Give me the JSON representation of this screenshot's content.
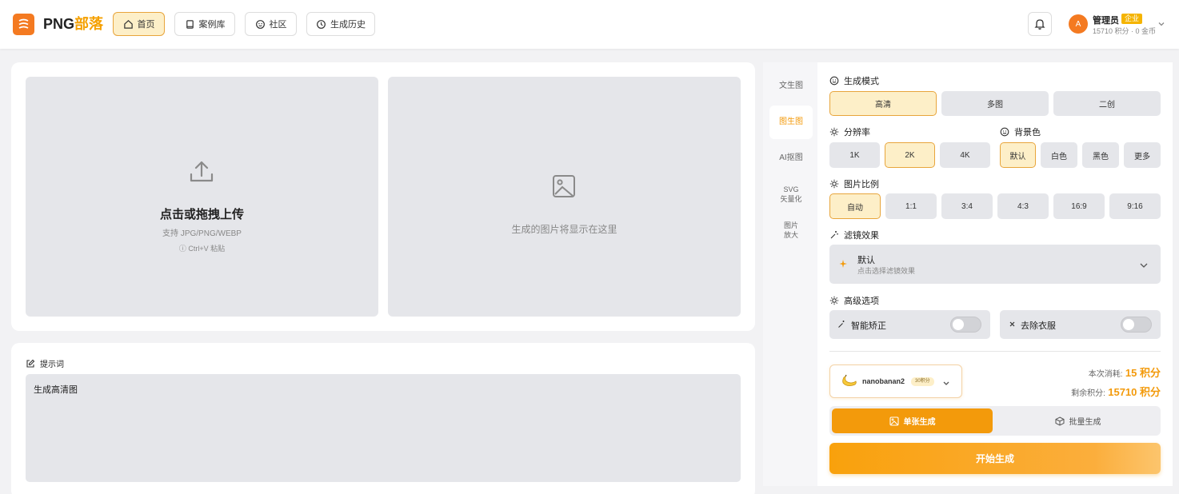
{
  "brand": {
    "name_part1": "PNG",
    "name_part2": "部落",
    "accent": "#f5a000",
    "logo_color": "#f47a21"
  },
  "nav": [
    {
      "label": "首页",
      "icon": "home-icon",
      "active": true
    },
    {
      "label": "案例库",
      "icon": "book-icon",
      "active": false
    },
    {
      "label": "社区",
      "icon": "smile-icon",
      "active": false
    },
    {
      "label": "生成历史",
      "icon": "clock-icon",
      "active": false
    }
  ],
  "user": {
    "avatar_letter": "A",
    "name": "管理员",
    "badge": "企业",
    "subtitle": "15710 积分 · 0 金币"
  },
  "upload": {
    "title": "点击或拖拽上传",
    "formats": "支持 JPG/PNG/WEBP",
    "paste_hint": "Ctrl+V 粘贴"
  },
  "output": {
    "placeholder": "生成的图片将显示在这里"
  },
  "prompt": {
    "label": "提示词",
    "value": "生成高清图"
  },
  "side_tabs": [
    {
      "label": "文生图",
      "active": false
    },
    {
      "label": "图生图",
      "active": true
    },
    {
      "label": "AI抠图",
      "active": false
    },
    {
      "label_line1": "SVG",
      "label_line2": "矢量化",
      "active": false
    },
    {
      "label_line1": "图片",
      "label_line2": "放大",
      "active": false
    }
  ],
  "settings": {
    "mode": {
      "label": "生成模式",
      "options": [
        "高清",
        "多图",
        "二创"
      ],
      "selected": "高清"
    },
    "resolution": {
      "label": "分辨率",
      "options": [
        "1K",
        "2K",
        "4K"
      ],
      "selected": "2K"
    },
    "background": {
      "label": "背景色",
      "options": [
        "默认",
        "白色",
        "黑色",
        "更多"
      ],
      "selected": "默认"
    },
    "ratio": {
      "label": "图片比例",
      "options": [
        "自动",
        "1:1",
        "3:4",
        "4:3",
        "16:9",
        "9:16"
      ],
      "selected": "自动"
    },
    "filter": {
      "label": "滤镜效果",
      "value": "默认",
      "hint": "点击选择滤镜效果"
    },
    "advanced": {
      "label": "高级选项",
      "smart_fix": "智能矫正",
      "remove_clothes": "去除衣服"
    }
  },
  "model": {
    "name": "nanobanan2",
    "cost_tag": "30积分"
  },
  "cost": {
    "this_label": "本次消耗:",
    "this_value": "15 积分",
    "remain_label": "剩余积分:",
    "remain_value": "15710 积分"
  },
  "gen_tabs": {
    "single": "单张生成",
    "batch": "批量生成"
  },
  "start_button": "开始生成",
  "colors": {
    "selected_bg": "#fdefc8",
    "selected_border": "#e8a53c",
    "orange": "#f39a0b"
  }
}
